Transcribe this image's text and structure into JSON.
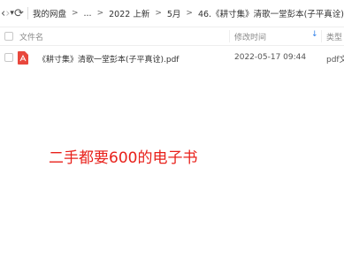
{
  "toolbar": {
    "back_icon": "‹",
    "forward_icon": "›",
    "dropdown_icon": "▾",
    "refresh_icon": "⟳"
  },
  "breadcrumb": [
    "我的网盘",
    "...",
    "2022 上新",
    "5月",
    "46.《耕寸集》清歌一堂彭本(子平真诠)"
  ],
  "breadcrumb_separator": ">",
  "table": {
    "headers": {
      "name": "文件名",
      "modified": "修改时间",
      "sort_indicator": "↓",
      "type": "类型"
    },
    "rows": [
      {
        "icon": "pdf-icon",
        "name": "《耕寸集》清歌一堂彭本(子平真诠).pdf",
        "modified": "2022-05-17 09:44",
        "type": "pdf文"
      }
    ]
  },
  "overlay_text": "二手都要600的电子书",
  "colors": {
    "accent_blue": "#2f7fe8",
    "pdf_red": "#e8473c",
    "overlay_red": "#e8201a"
  }
}
